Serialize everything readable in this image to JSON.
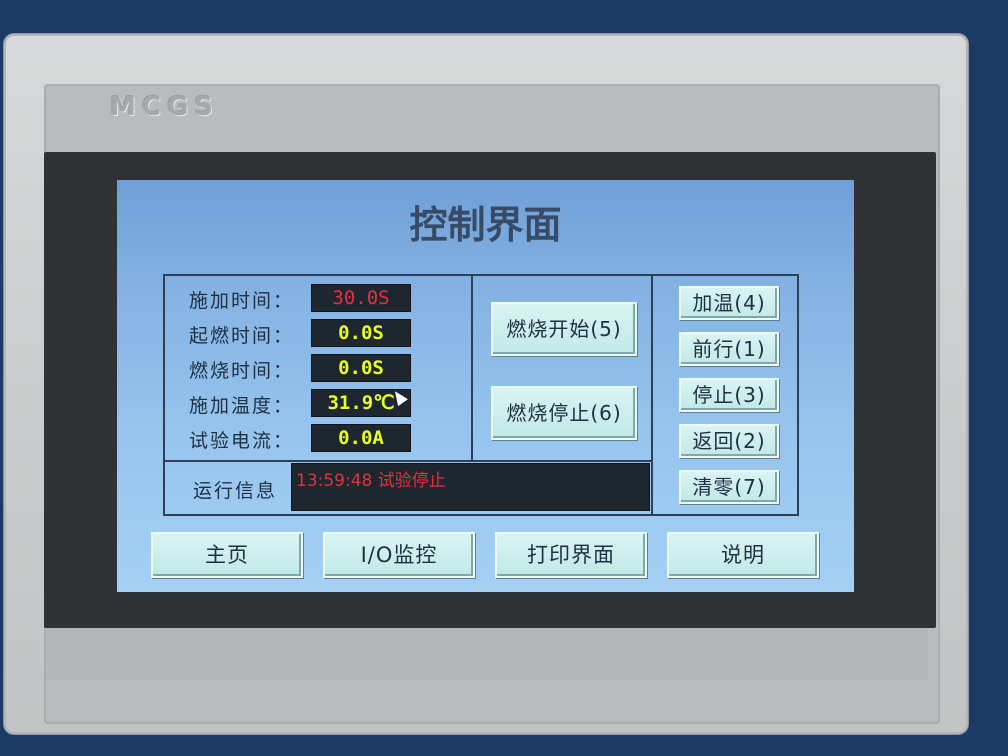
{
  "device": {
    "brand": "MCGS"
  },
  "screen": {
    "title": "控制界面",
    "readouts": [
      {
        "label": "施加时间：",
        "value": "30.0S",
        "color": "#e5313a"
      },
      {
        "label": "起燃时间：",
        "value": "0.0S",
        "color": "#e8ff22"
      },
      {
        "label": "燃烧时间：",
        "value": "0.0S",
        "color": "#e8ff22"
      },
      {
        "label": "施加温度：",
        "value": "31.9℃",
        "color": "#e8ff22"
      },
      {
        "label": "试验电流：",
        "value": "0.0A",
        "color": "#e8ff22"
      }
    ],
    "center_buttons": [
      {
        "label": "燃烧开始(5)"
      },
      {
        "label": "燃烧停止(6)"
      }
    ],
    "side_buttons": [
      {
        "label": "加温(4)"
      },
      {
        "label": "前行(1)"
      },
      {
        "label": "停止(3)"
      },
      {
        "label": "返回(2)"
      },
      {
        "label": "清零(7)"
      }
    ],
    "info": {
      "label": "运行信息",
      "message": "13:59:48 试验停止"
    },
    "nav": [
      {
        "label": "主页"
      },
      {
        "label": "I/O监控"
      },
      {
        "label": "打印界面"
      },
      {
        "label": "说明"
      }
    ]
  }
}
